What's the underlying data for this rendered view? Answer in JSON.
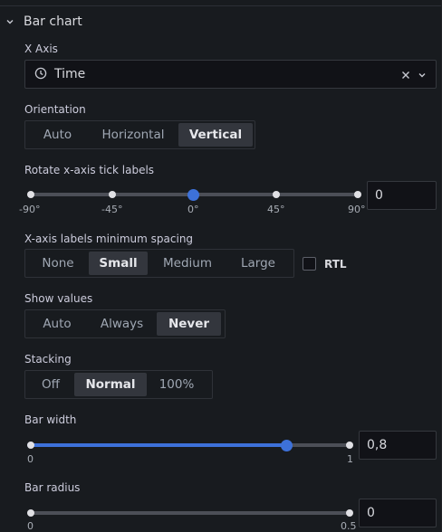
{
  "section": {
    "title": "Bar chart"
  },
  "x_axis": {
    "label": "X Axis",
    "value": "Time",
    "icon": "clock-icon"
  },
  "orientation": {
    "label": "Orientation",
    "options": [
      "Auto",
      "Horizontal",
      "Vertical"
    ],
    "selected": "Vertical"
  },
  "rotate_ticks": {
    "label": "Rotate x-axis tick labels",
    "ticks": [
      "-90°",
      "-45°",
      "0°",
      "45°",
      "90°"
    ],
    "value": "0",
    "slider_fraction": 0.5
  },
  "min_spacing": {
    "label": "X-axis labels minimum spacing",
    "options": [
      "None",
      "Small",
      "Medium",
      "Large"
    ],
    "selected": "Small",
    "rtl_label": "RTL"
  },
  "show_values": {
    "label": "Show values",
    "options": [
      "Auto",
      "Always",
      "Never"
    ],
    "selected": "Never"
  },
  "stacking": {
    "label": "Stacking",
    "options": [
      "Off",
      "Normal",
      "100%"
    ],
    "selected": "Normal"
  },
  "bar_width": {
    "label": "Bar width",
    "min": "0",
    "max": "1",
    "value": "0,8",
    "slider_fraction": 0.8
  },
  "bar_radius": {
    "label": "Bar radius",
    "min": "0",
    "max": "0.5",
    "value": "0",
    "slider_fraction": 0
  },
  "colors": {
    "accent": "#3d71d9",
    "background": "#181b1f"
  }
}
